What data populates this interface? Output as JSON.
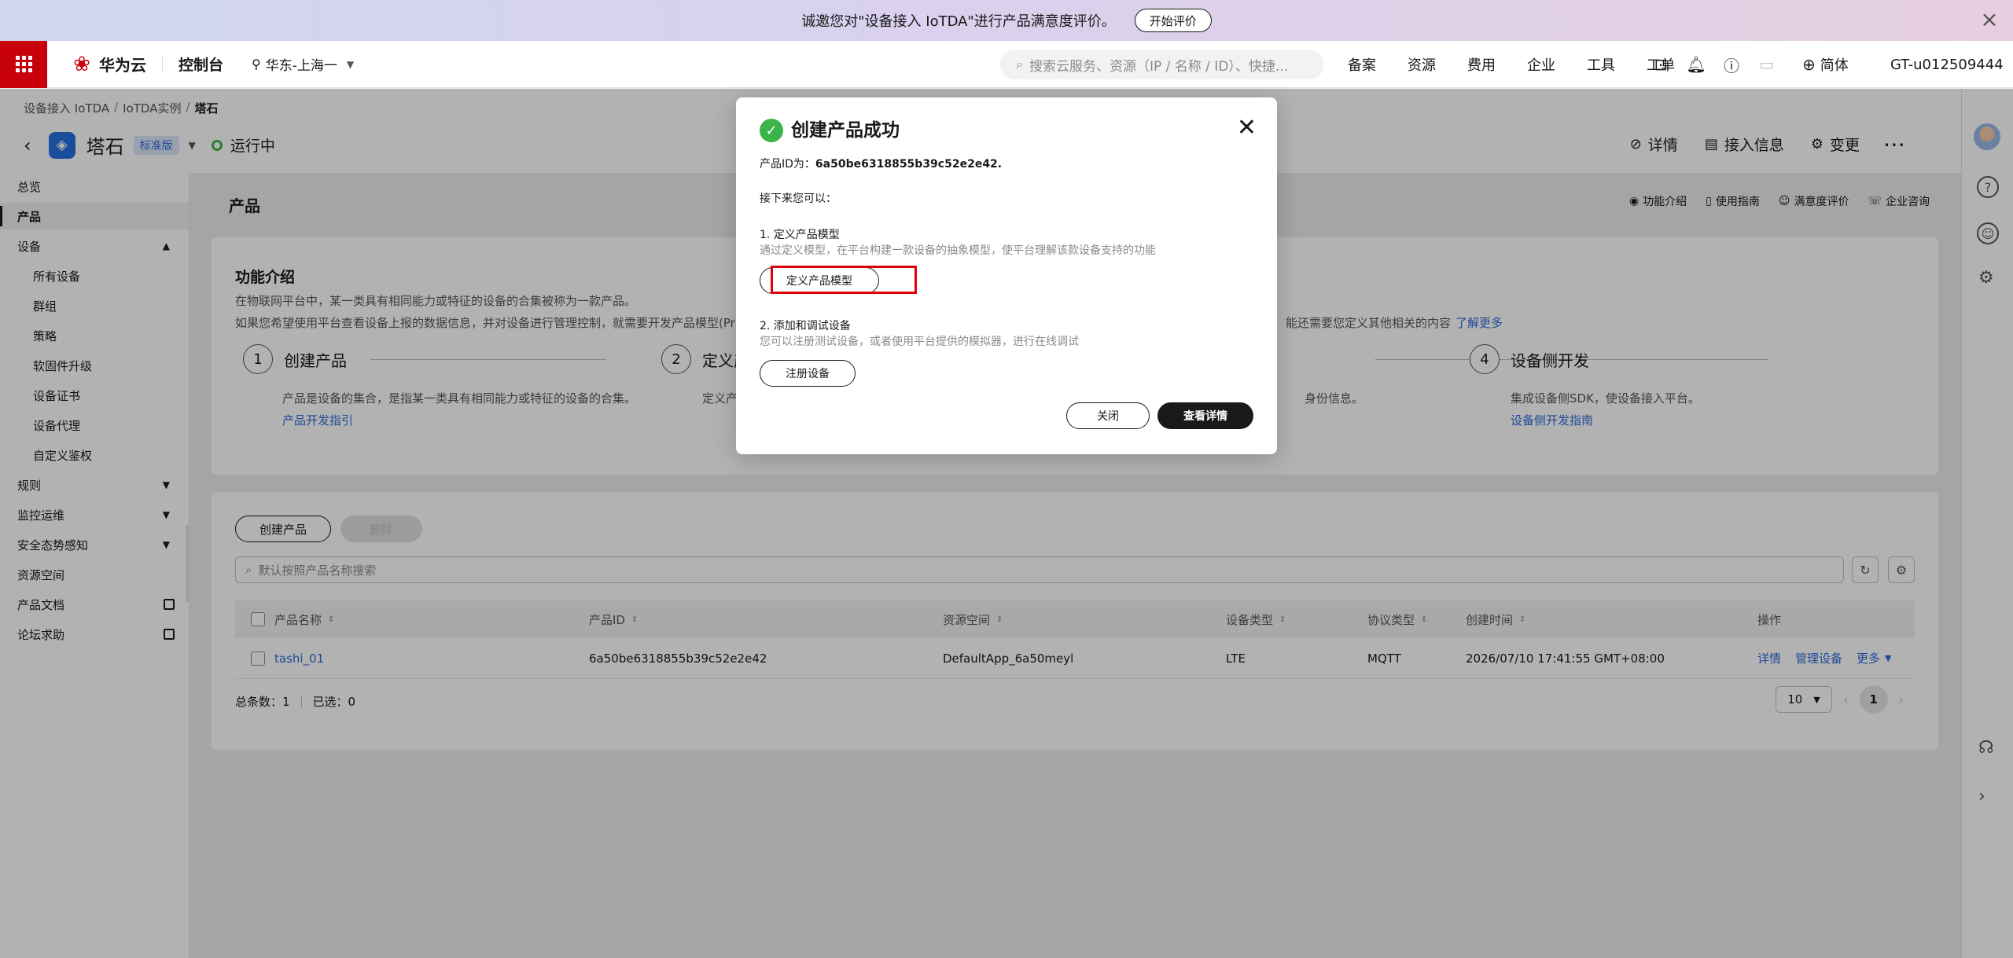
{
  "banner": {
    "text": "诚邀您对\"设备接入 IoTDA\"进行产品满意度评价。",
    "button": "开始评价"
  },
  "topnav": {
    "logo_text": "华为云",
    "console": "控制台",
    "region": "华东-上海一",
    "search_placeholder": "搜索云服务、资源（IP / 名称 / ID）、快捷...",
    "links": [
      "备案",
      "资源",
      "费用",
      "企业",
      "工具",
      "工单"
    ],
    "language": "简体",
    "account": "GT-u012509444"
  },
  "breadcrumb": {
    "items": [
      "设备接入 IoTDA",
      "IoTDA实例"
    ],
    "current": "塔石"
  },
  "instance": {
    "name": "塔石",
    "edition": "标准版",
    "status": "运行中",
    "status_color": "#3bb54a"
  },
  "header_actions": [
    "详情",
    "接入信息",
    "变更"
  ],
  "sidebar": {
    "items": [
      {
        "label": "总览"
      },
      {
        "label": "产品",
        "active": true
      },
      {
        "label": "设备",
        "expanded": true
      },
      {
        "label": "所有设备",
        "sub": true
      },
      {
        "label": "群组",
        "sub": true
      },
      {
        "label": "策略",
        "sub": true
      },
      {
        "label": "软固件升级",
        "sub": true
      },
      {
        "label": "设备证书",
        "sub": true
      },
      {
        "label": "设备代理",
        "sub": true
      },
      {
        "label": "自定义鉴权",
        "sub": true
      },
      {
        "label": "规则",
        "chevron": "down"
      },
      {
        "label": "监控运维",
        "chevron": "down"
      },
      {
        "label": "安全态势感知",
        "chevron": "down"
      },
      {
        "label": "资源空间"
      },
      {
        "label": "产品文档",
        "external": true
      },
      {
        "label": "论坛求助",
        "external": true
      }
    ]
  },
  "main": {
    "title": "产品",
    "help_links": [
      "功能介绍",
      "使用指南",
      "满意度评价",
      "企业咨询"
    ],
    "intro": {
      "title": "功能介绍",
      "desc1": "在物联网平台中，某一类具有相同能力或特征的设备的合集被称为一款产品。",
      "desc2": "如果您希望使用平台查看设备上报的数据信息，并对设备进行管理控制，就需要开发产品模型(Pr",
      "desc2_tail": "能还需要您定义其他相关的内容",
      "learn_more": "了解更多",
      "steps": [
        {
          "num": "1",
          "name": "创建产品",
          "desc": "产品是设备的集合，是指某一类具有相同能力或特征的设备的合集。",
          "link": "产品开发指引"
        },
        {
          "num": "2",
          "name": "定义产",
          "desc": "定义产"
        },
        {
          "num": "3",
          "name": "",
          "desc": "身份信息。"
        },
        {
          "num": "4",
          "name": "设备侧开发",
          "desc": "集成设备侧SDK，使设备接入平台。",
          "link": "设备侧开发指南"
        }
      ]
    },
    "products": {
      "create_button": "创建产品",
      "delete_button": "删除",
      "search_placeholder": "默认按照产品名称搜索",
      "columns": [
        "产品名称",
        "产品ID",
        "资源空间",
        "设备类型",
        "协议类型",
        "创建时间",
        "操作"
      ],
      "rows": [
        {
          "name": "tashi_01",
          "id": "6a50be6318855b39c52e2e42",
          "space": "DefaultApp_6a50meyl",
          "device_type": "LTE",
          "protocol": "MQTT",
          "created": "2026/07/10 17:41:55 GMT+08:00",
          "ops": [
            "详情",
            "管理设备",
            "更多"
          ]
        }
      ],
      "footer": {
        "total": "总条数：1",
        "selected": "已选：0"
      },
      "pager": {
        "size": "10",
        "page": "1"
      }
    }
  },
  "modal": {
    "title": "创建产品成功",
    "id_label": "产品ID为：",
    "id_value": "6a50be6318855b39c52e2e42.",
    "next_label": "接下来您可以：",
    "step1_title": "1. 定义产品模型",
    "step1_desc": "通过定义模型，在平台构建一款设备的抽象模型，使平台理解该款设备支持的功能",
    "step1_button": "定义产品模型",
    "step2_title": "2. 添加和调试设备",
    "step2_desc": "您可以注册测试设备，或者使用平台提供的模拟器，进行在线调试",
    "step2_button": "注册设备",
    "close_button": "关闭",
    "view_button": "查看详情",
    "highlight_color": "#e0000b"
  }
}
